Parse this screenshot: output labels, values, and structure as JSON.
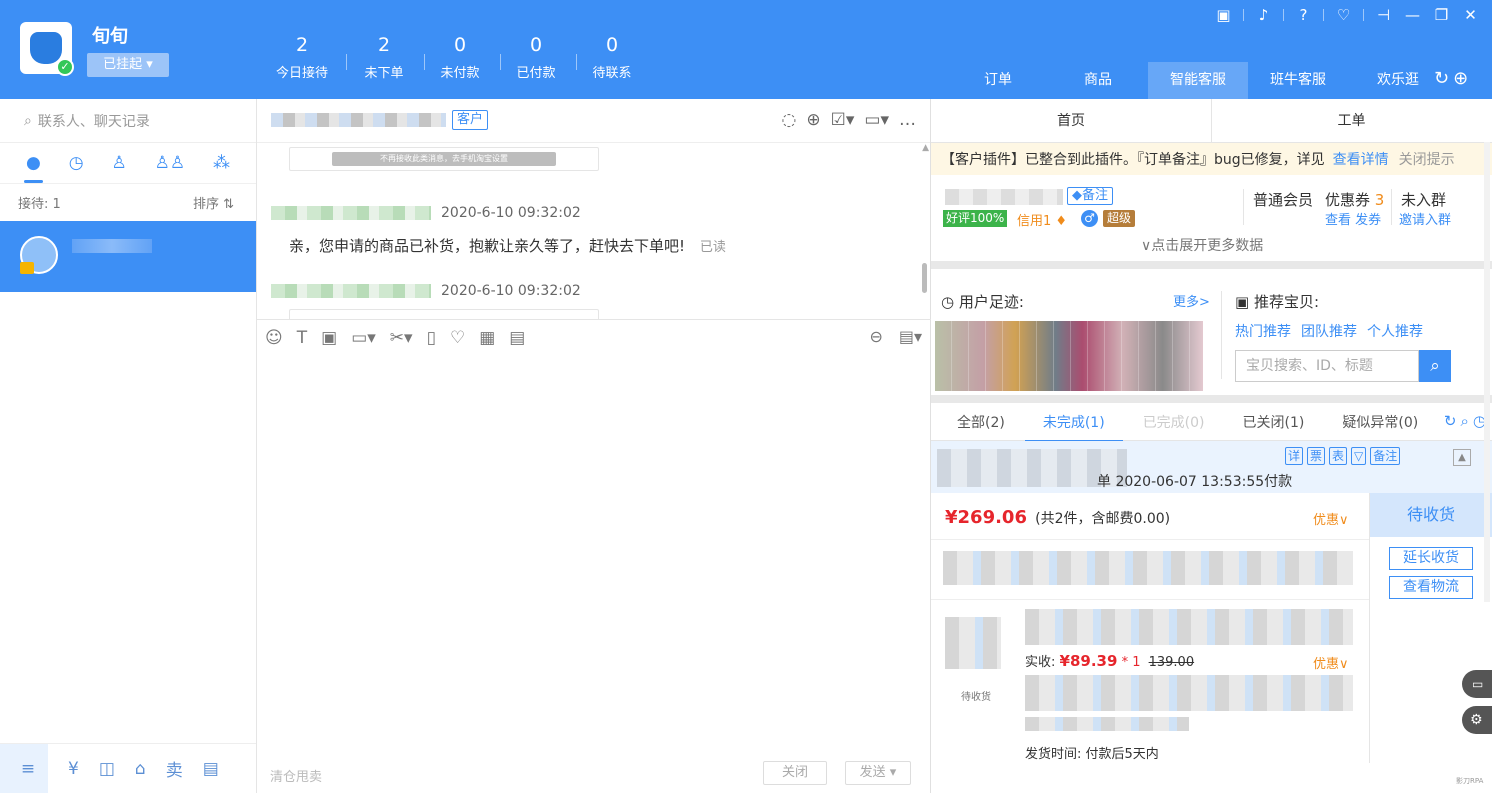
{
  "app": {
    "shop_name": "旬旬",
    "status": "已挂起 ▾"
  },
  "stats": [
    {
      "num": "2",
      "label": "今日接待"
    },
    {
      "num": "2",
      "label": "未下单"
    },
    {
      "num": "0",
      "label": "未付款"
    },
    {
      "num": "0",
      "label": "已付款"
    },
    {
      "num": "0",
      "label": "待联系"
    }
  ],
  "main_tabs": [
    "订单",
    "商品",
    "智能客服",
    "班牛客服",
    "欢乐逛"
  ],
  "left": {
    "search_placeholder": "联系人、聊天记录",
    "reception_label": "接待: 1",
    "sort_label": "排序 ⇅"
  },
  "chat": {
    "customer_tag": "客户",
    "system_notice": "不再接收此类消息，去手机淘宝设置",
    "messages": [
      {
        "time": "2020-6-10 09:32:02",
        "text": "亲，您申请的商品已补货，抱歉让亲久等了，赶快去下单吧!",
        "read": "已读"
      },
      {
        "time": "2020-6-10 09:32:02"
      }
    ],
    "quick_phrase": "清仓甩卖",
    "close_label": "关闭",
    "send_label": "发送 ▾"
  },
  "right": {
    "tabs": [
      "首页",
      "工单"
    ],
    "notice": {
      "text": "【客户插件】已整合到此插件。『订单备注』bug已修复，详见",
      "link": "查看详情",
      "dismiss": "关闭提示"
    },
    "member": {
      "remark_tag": "◆备注",
      "good_rate": "好评100%",
      "credit": "信用1",
      "gender_icon": "♂",
      "level": "超级",
      "expand": "∨点击展开更多数据",
      "member_type": "普通会员",
      "coupon_label": "优惠券",
      "coupon_count": "3",
      "coupon_actions": "查看 发券",
      "group_status": "未入群",
      "group_action": "邀请入群"
    },
    "footprint": {
      "title": "用户足迹:",
      "more": "更多>"
    },
    "recommend": {
      "title": "推荐宝贝:",
      "links": [
        "热门推荐",
        "团队推荐",
        "个人推荐"
      ],
      "search_placeholder": "宝贝搜索、ID、标题"
    },
    "order_tabs": [
      "全部(2)",
      "未完成(1)",
      "已完成(0)",
      "已关闭(1)",
      "疑似异常(0)"
    ],
    "order": {
      "head_icons": [
        "详",
        "票",
        "表",
        "▽",
        "备注"
      ],
      "time": "单 2020-06-07 13:53:55付款",
      "price": "¥269.06",
      "price_detail": "(共2件，含邮费0.00)",
      "discount": "优惠∨",
      "status": "待收货",
      "extend_label": "延长收货",
      "logistics_label": "查看物流",
      "actual_label": "实收:",
      "actual_price": "¥89.39",
      "qty": "* 1",
      "original_price": "139.00",
      "item_status": "待收货",
      "ship_time": "发货时间: 付款后5天内"
    },
    "watermark": "影刀RPA"
  },
  "colors": {
    "primary": "#3d8ff5",
    "price_red": "#e6252c",
    "orange": "#f08c1c",
    "good_green": "#3cb34a",
    "notice_bg": "#fef7e4"
  }
}
